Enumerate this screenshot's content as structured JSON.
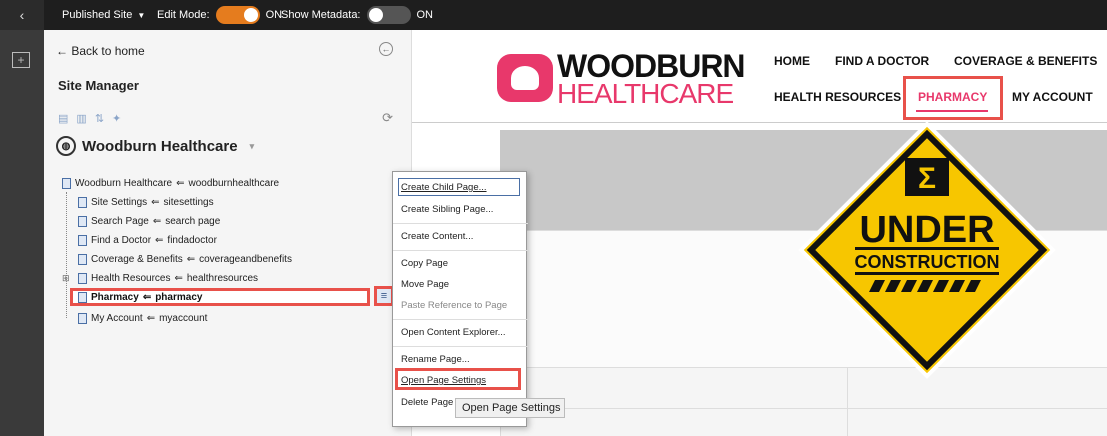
{
  "topbar": {
    "back_glyph": "‹",
    "published_site": "Published Site",
    "edit_mode_label": "Edit Mode:",
    "edit_mode_state": "ON",
    "show_metadata_label": "Show Metadata:",
    "show_metadata_state": "ON"
  },
  "panel": {
    "back_home": "Back to home",
    "title": "Site Manager",
    "site_name": "Woodburn Healthcare",
    "tree": [
      {
        "label": "Woodburn Healthcare",
        "alias": "woodburnhealthcare"
      },
      {
        "label": "Site Settings",
        "alias": "sitesettings"
      },
      {
        "label": "Search Page",
        "alias": "search page"
      },
      {
        "label": "Find a Doctor",
        "alias": "findadoctor"
      },
      {
        "label": "Coverage & Benefits",
        "alias": "coverageandbenefits"
      },
      {
        "label": "Health Resources",
        "alias": "healthresources"
      },
      {
        "label": "Pharmacy",
        "alias": "pharmacy"
      },
      {
        "label": "My Account",
        "alias": "myaccount"
      }
    ]
  },
  "context_menu": {
    "items": [
      "Create Child Page...",
      "Create Sibling Page...",
      "Create Content...",
      "Copy Page",
      "Move Page",
      "Paste Reference to Page",
      "Open Content Explorer...",
      "Rename Page...",
      "Open Page Settings",
      "Delete Page"
    ],
    "tooltip": "Open Page Settings"
  },
  "site": {
    "logo_line1": "WOODBURN",
    "logo_line2": "HEALTHCARE",
    "nav_row1": [
      "HOME",
      "FIND A DOCTOR",
      "COVERAGE & BENEFITS"
    ],
    "nav_row2": [
      "HEALTH RESOURCES",
      "PHARMACY",
      "MY ACCOUNT"
    ],
    "sign_line1": "UNDER",
    "sign_line2": "CONSTRUCTION"
  },
  "colors": {
    "accent_orange": "#e57c1e",
    "brand_pink": "#e8386b",
    "highlight_red": "#e8514a",
    "sign_yellow": "#f7c600"
  }
}
